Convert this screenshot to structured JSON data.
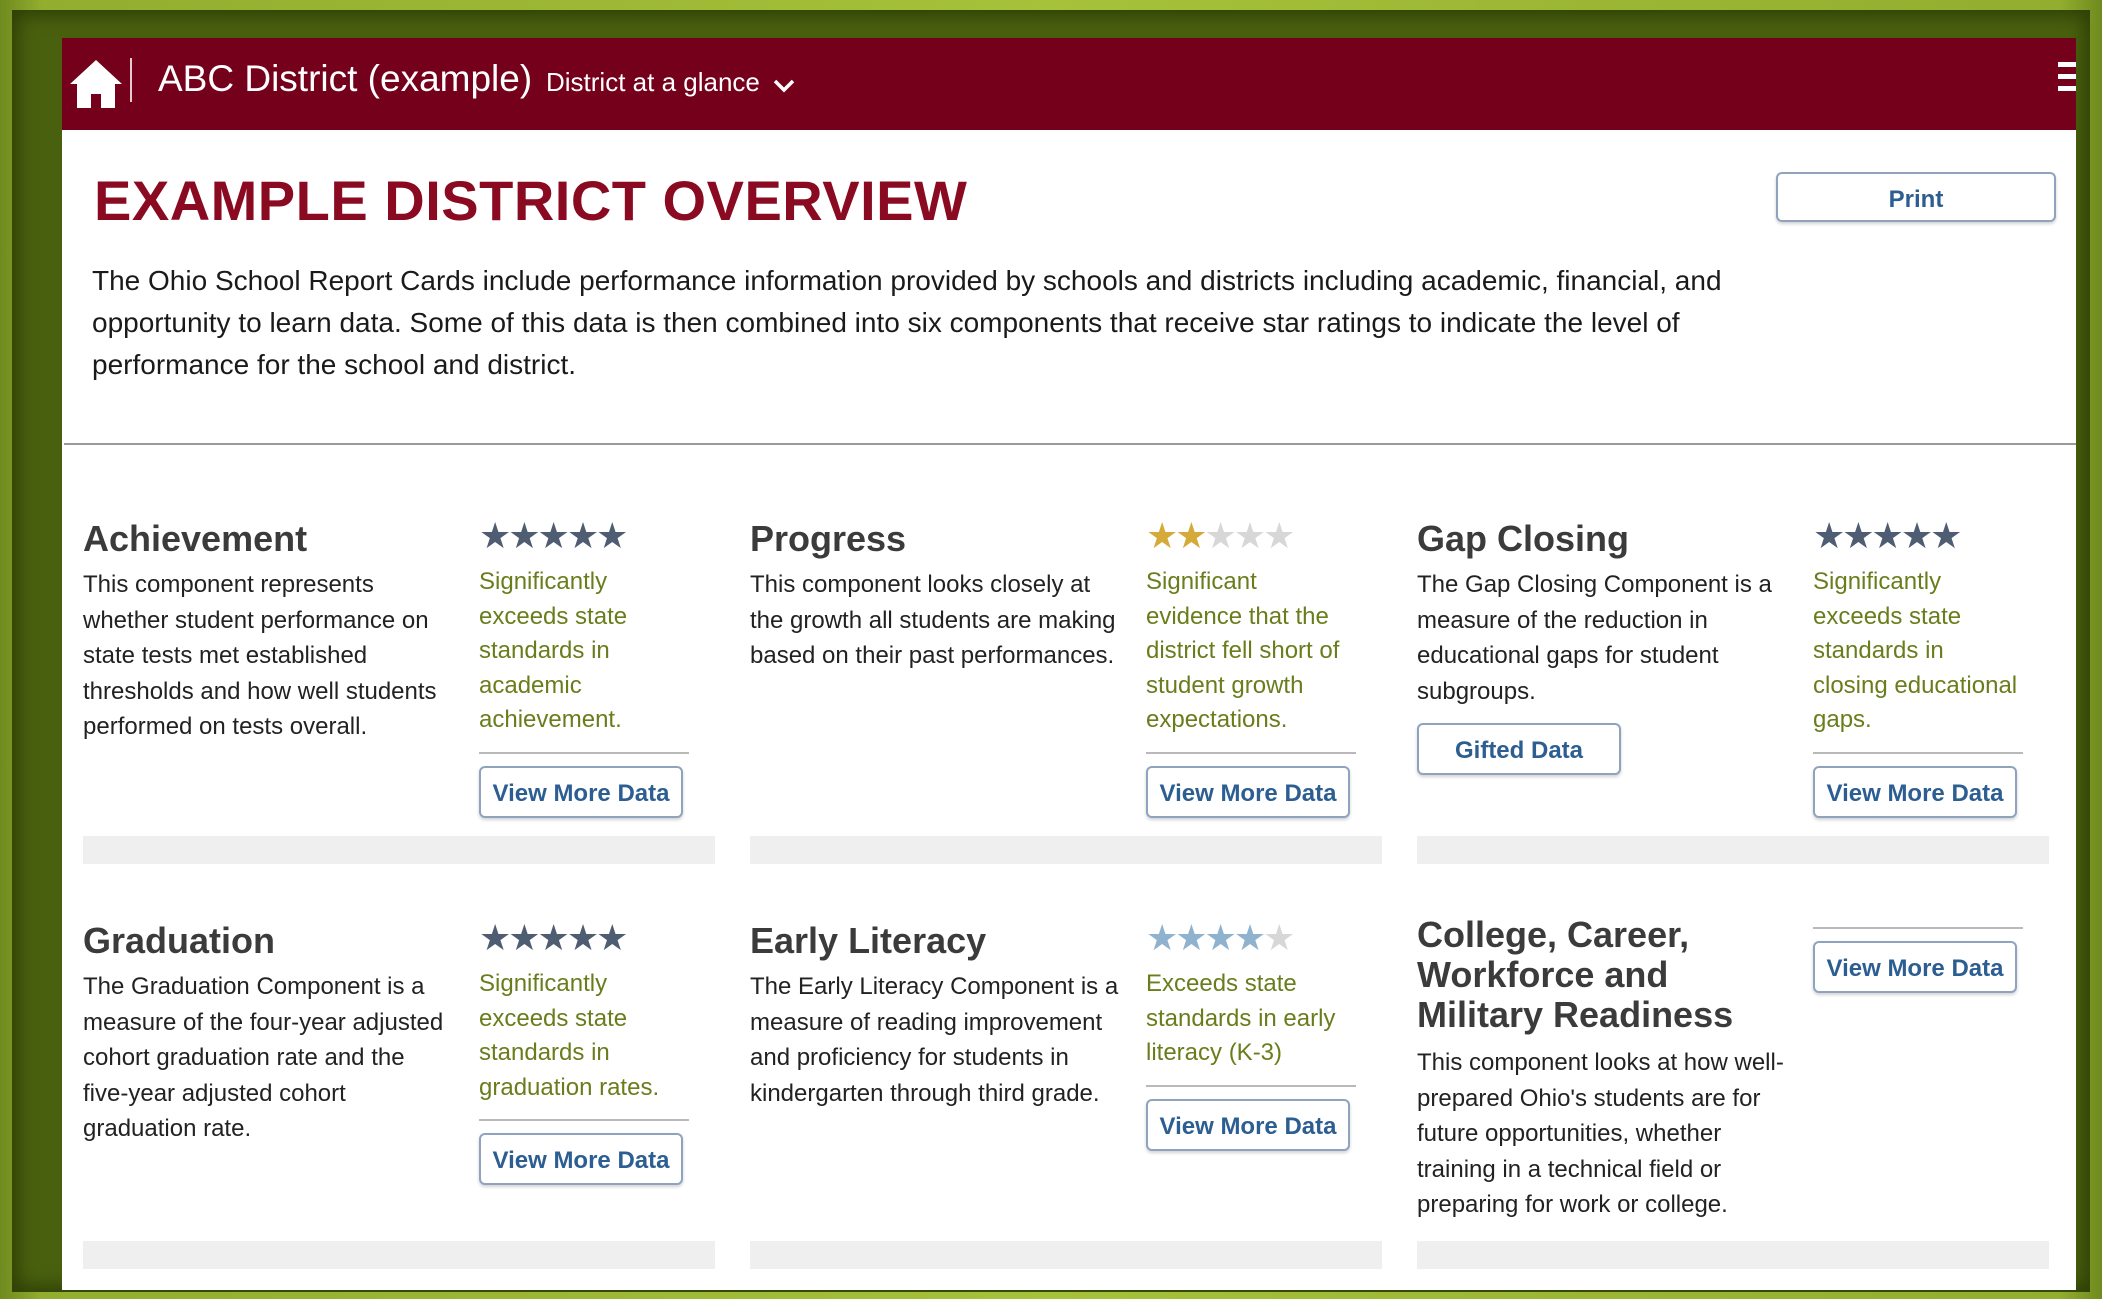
{
  "header": {
    "district_name": "ABC District (example)",
    "view_label": "District at a glance"
  },
  "page": {
    "title": "EXAMPLE DISTRICT OVERVIEW",
    "print_label": "Print",
    "intro": "The Ohio School Report Cards include performance information provided by schools and districts including academic, financial, and opportunity to learn data. Some of this data is then combined into six components that receive star ratings to indicate the level of performance for the school and district."
  },
  "components": [
    {
      "name": "Achievement",
      "description": "This component represents whether student performance on state tests met established thresholds and how well students performed on tests overall.",
      "stars": 5,
      "star_color": "#4f5d73",
      "rating_text": "Significantly exceeds state standards in academic achievement.",
      "button_label": "View More Data"
    },
    {
      "name": "Progress",
      "description": "This component looks closely at the growth all students are making based on their past performances.",
      "stars": 2,
      "star_color": "#d6a93b",
      "rating_text": "Significant evidence that the district fell short of student growth expectations.",
      "button_label": "View More Data"
    },
    {
      "name": "Gap Closing",
      "description": "The Gap Closing Component is a measure of the reduction in educational gaps for student subgroups.",
      "stars": 5,
      "star_color": "#4f5d73",
      "rating_text": "Significantly exceeds state standards in closing educational gaps.",
      "button_label": "View More Data",
      "extra_button_label": "Gifted Data"
    },
    {
      "name": "Graduation",
      "description": "The Graduation Component is a measure of the four-year adjusted cohort graduation rate and the five-year adjusted cohort graduation rate.",
      "stars": 5,
      "star_color": "#4f5d73",
      "rating_text": "Significantly exceeds state standards in graduation rates.",
      "button_label": "View More Data"
    },
    {
      "name": "Early Literacy",
      "description": "The Early Literacy Component is a measure of reading improvement and proficiency for students in kindergarten through third grade.",
      "stars": 4,
      "star_color": "#8fb3cf",
      "rating_text": "Exceeds state standards in early literacy (K-3)",
      "button_label": "View More Data"
    },
    {
      "name": "College, Career, Workforce and Military Readiness",
      "description": "This component looks at how well-prepared Ohio's students are for future opportunities, whether training in a technical field or preparing for work or college.",
      "button_label": "View More Data"
    }
  ],
  "colors": {
    "brand_bar": "#74001b",
    "title": "#8a0a22",
    "rating_text": "#6a7d1c",
    "button_text": "#2d5e92"
  }
}
